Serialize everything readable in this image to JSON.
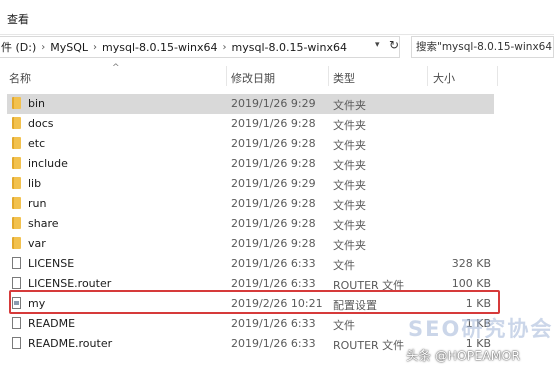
{
  "ribbon": {
    "view_label": "查看"
  },
  "address": {
    "crumbs": [
      "件 (D:)",
      "MySQL",
      "mysql-8.0.15-winx64",
      "mysql-8.0.15-winx64"
    ],
    "search_placeholder": "搜索\"mysql-8.0.15-winx64\""
  },
  "columns": {
    "name": "名称",
    "date": "修改日期",
    "type": "类型",
    "size": "大小"
  },
  "files": [
    {
      "name": "bin",
      "date": "2019/1/26 9:29",
      "type": "文件夹",
      "size": "",
      "icon": "folder-icon"
    },
    {
      "name": "docs",
      "date": "2019/1/26 9:28",
      "type": "文件夹",
      "size": "",
      "icon": "folder-icon"
    },
    {
      "name": "etc",
      "date": "2019/1/26 9:28",
      "type": "文件夹",
      "size": "",
      "icon": "folder-icon"
    },
    {
      "name": "include",
      "date": "2019/1/26 9:28",
      "type": "文件夹",
      "size": "",
      "icon": "folder-icon"
    },
    {
      "name": "lib",
      "date": "2019/1/26 9:29",
      "type": "文件夹",
      "size": "",
      "icon": "folder-icon"
    },
    {
      "name": "run",
      "date": "2019/1/26 9:28",
      "type": "文件夹",
      "size": "",
      "icon": "folder-icon"
    },
    {
      "name": "share",
      "date": "2019/1/26 9:28",
      "type": "文件夹",
      "size": "",
      "icon": "folder-icon"
    },
    {
      "name": "var",
      "date": "2019/1/26 9:28",
      "type": "文件夹",
      "size": "",
      "icon": "folder-icon"
    },
    {
      "name": "LICENSE",
      "date": "2019/1/26 6:33",
      "type": "文件",
      "size": "328 KB",
      "icon": "file-icon"
    },
    {
      "name": "LICENSE.router",
      "date": "2019/1/26 6:33",
      "type": "ROUTER 文件",
      "size": "100 KB",
      "icon": "file-icon"
    },
    {
      "name": "my",
      "date": "2019/2/26 10:21",
      "type": "配置设置",
      "size": "1 KB",
      "icon": "config-file-icon"
    },
    {
      "name": "README",
      "date": "2019/1/26 6:33",
      "type": "文件",
      "size": "1 KB",
      "icon": "file-icon"
    },
    {
      "name": "README.router",
      "date": "2019/1/26 6:33",
      "type": "ROUTER 文件",
      "size": "1 KB",
      "icon": "file-icon"
    }
  ],
  "watermarks": {
    "seo": "SEO研究协会网",
    "author": "头条 @HOPEAMOR"
  }
}
